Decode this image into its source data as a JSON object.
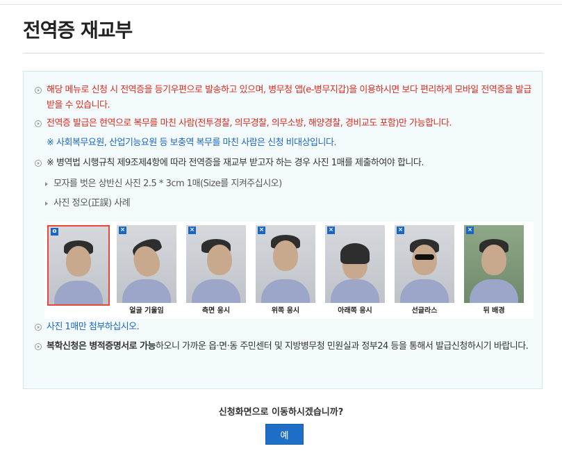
{
  "page": {
    "title": "전역증 재교부"
  },
  "notice": {
    "item1": "해당 메뉴로 신청 시 전역증을 등기우편으로 발송하고 있으며, 병무청 앱(e-병무지갑)을 이용하시면 보다 편리하게 모바일 전역증을 발급 받을 수 있습니다.",
    "item2": "전역증 발급은 현역으로 복무를 마친 사람(전투경찰, 의무경찰, 의무소방, 해양경찰, 경비교도 포함)만 가능합니다.",
    "item2_note": "※ 사회복무요원, 산업기능요원 등 보충역 복무를 마친 사람은 신청 비대상입니다.",
    "item3": "※ 병역법 시행규칙 제9조제4항에 따라 전역증을 재교부 받고자 하는 경우 사진 1매를 제출하여야 합니다.",
    "sub1": "모자를 벗은 상반신 사진 2.5 * 3cm 1매(Size를 지켜주십시오)",
    "sub2": "사진 정오(正誤) 사례",
    "item4": "사진 1매만 첨부하십시오.",
    "item5_bold": "복학신청은 병적증명서로 가능",
    "item5_rest": "하오니 가까운 읍·면·동 주민센터 및 지방병무청 민원실과 정부24 등을 통해서 발급신청하시기 바랍니다."
  },
  "photos": {
    "correct_mark": "o",
    "wrong_mark": "×",
    "captions": [
      "",
      "얼굴 기울임",
      "측면 응시",
      "위쪽 응시",
      "아래쪽 응시",
      "선글라스",
      "뒤 배경"
    ]
  },
  "confirm": {
    "question": "신청화면으로 이동하시겠습니까?",
    "yes_label": "예"
  },
  "colors": {
    "accent_blue": "#1f6fc8",
    "notice_red": "#e02a1f",
    "note_blue": "#1a66c5",
    "box_bg": "#f4fbfd"
  }
}
